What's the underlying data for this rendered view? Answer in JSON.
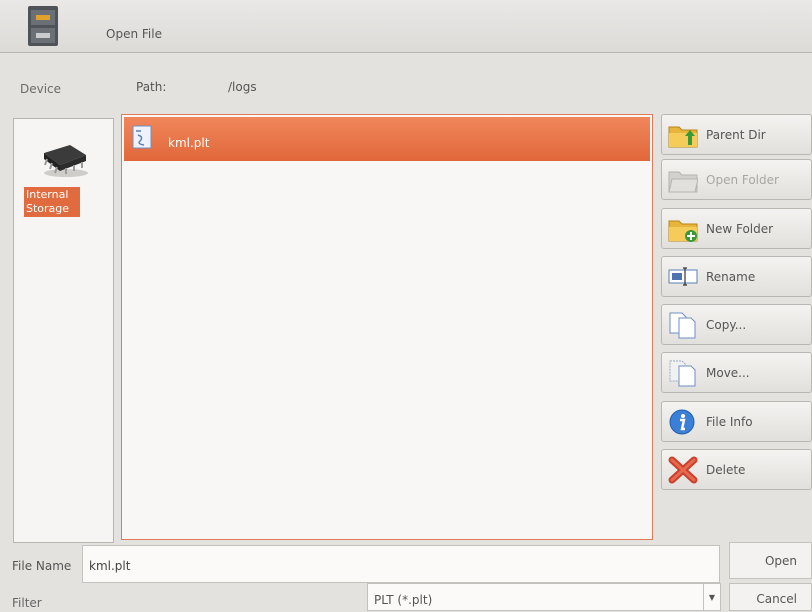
{
  "window": {
    "title": "Open File"
  },
  "location": {
    "device_label": "Device",
    "path_label": "Path:",
    "path_value": "/logs"
  },
  "devices": [
    {
      "label": "Internal Storage",
      "icon": "chip-icon",
      "selected": true
    }
  ],
  "files": [
    {
      "name": "kml.plt",
      "icon": "plt-file-icon",
      "selected": true
    }
  ],
  "actions": {
    "parent_dir": "Parent Dir",
    "open_folder": "Open Folder",
    "new_folder": "New Folder",
    "rename": "Rename",
    "copy": "Copy...",
    "move": "Move...",
    "file_info": "File Info",
    "delete": "Delete"
  },
  "footer": {
    "file_name_label": "File Name",
    "file_name_value": "kml.plt",
    "open_label": "Open",
    "filter_label": "Filter",
    "filter_value": "PLT (*.plt)",
    "cancel_label": "Cancel"
  },
  "colors": {
    "accent": "#e56f42",
    "background": "#e4e2df",
    "panel": "#f8f7f5"
  }
}
